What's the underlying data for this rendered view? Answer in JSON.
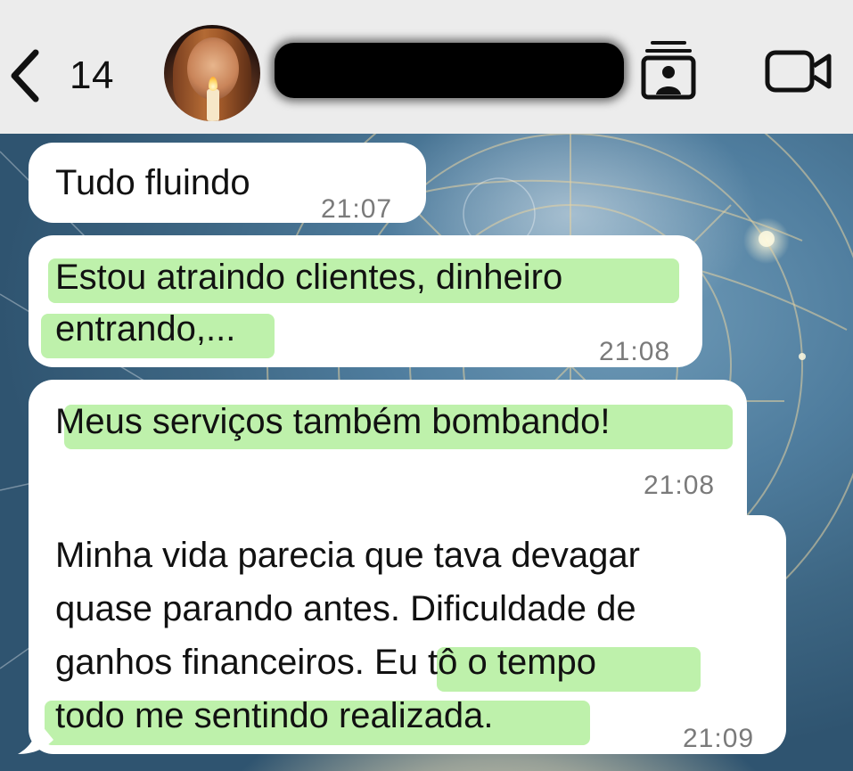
{
  "header": {
    "back_count": "14",
    "contact_name_redacted": true
  },
  "icons": {
    "back": "chevron-left-icon",
    "contact_card": "contact-card-icon",
    "video": "video-camera-icon"
  },
  "colors": {
    "bubble": "#ffffff",
    "highlight": "#96e878",
    "time": "#7a7a7a"
  },
  "messages": [
    {
      "lines": [
        "Tudo fluindo"
      ],
      "time": "21:07"
    },
    {
      "lines": [
        "Estou atraindo clientes, dinheiro",
        "entrando,..."
      ],
      "time": "21:08"
    },
    {
      "lines": [
        "Meus serviços também bombando!"
      ],
      "time": "21:08"
    },
    {
      "lines": [
        "Minha vida parecia que tava devagar",
        "quase parando antes. Dificuldade de",
        "ganhos financeiros. Eu tô o tempo",
        "todo me sentindo realizada."
      ],
      "time": "21:09"
    }
  ]
}
